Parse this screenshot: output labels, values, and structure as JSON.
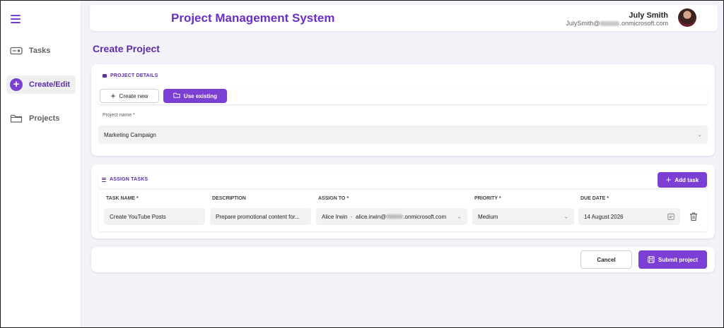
{
  "app": {
    "title": "Project Management System"
  },
  "user": {
    "name": "July Smith",
    "email_prefix": "JulySmith@",
    "email_suffix": ".onmicrosoft.com"
  },
  "sidebar": {
    "items": [
      {
        "label": "Tasks",
        "icon": "task-card-icon"
      },
      {
        "label": "Create/Edit",
        "icon": "add-circle-icon",
        "active": true
      },
      {
        "label": "Projects",
        "icon": "folder-icon"
      }
    ]
  },
  "page": {
    "title": "Create Project"
  },
  "project_details": {
    "section_label": "PROJECT DETAILS",
    "create_new_label": "Create new",
    "use_existing_label": "Use existing",
    "project_name_label": "Project name *",
    "project_name_value": "Marketing Campaign"
  },
  "assign_tasks": {
    "section_label": "ASSIGN TASKS",
    "add_task_label": "Add task",
    "columns": [
      "TASK NAME *",
      "DESCRIPTION",
      "ASSIGN TO *",
      "PRIORITY *",
      "DUE DATE *"
    ],
    "rows": [
      {
        "task_name": "Create YouTube Posts",
        "description": "Prepare promotional content for...",
        "assignee_name": "Alice Irwin",
        "assignee_email_prefix": "alice.irwin@",
        "assignee_email_suffix": ".onmicrosoft.com",
        "priority": "Medium",
        "due_date": "14 August 2026"
      }
    ]
  },
  "actions": {
    "cancel_label": "Cancel",
    "submit_label": "Submit project"
  },
  "colors": {
    "accent": "#7b3fd3",
    "accent_dark": "#5b2da6",
    "background": "#f3f2f9"
  }
}
